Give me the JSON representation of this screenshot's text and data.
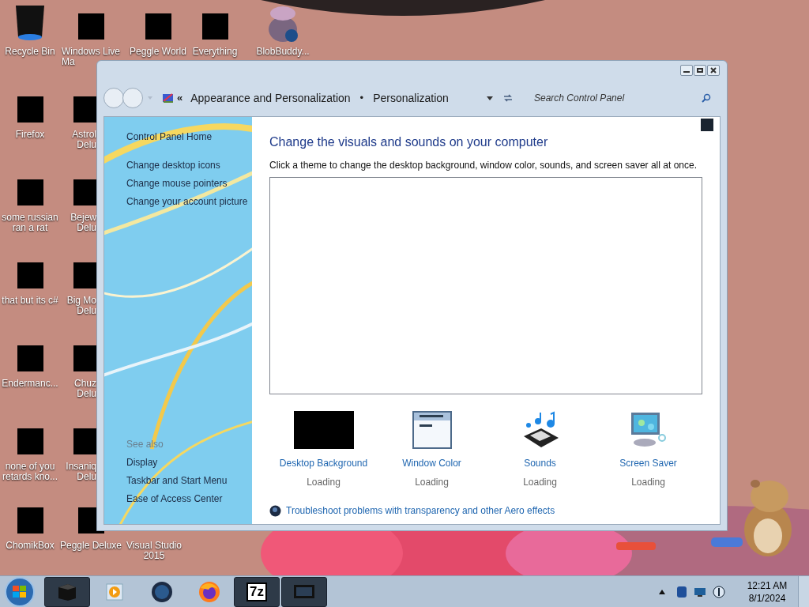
{
  "desktop_icons": [
    {
      "lines": [
        "Recycle Bin"
      ],
      "kind": "bin"
    },
    {
      "lines": [
        "Windows Live",
        "Ma"
      ],
      "kind": "redacted"
    },
    {
      "lines": [
        "Peggle World"
      ],
      "kind": "redacted"
    },
    {
      "lines": [
        "Everything"
      ],
      "kind": "redacted"
    },
    {
      "lines": [
        "BlobBuddy..."
      ],
      "kind": "blob"
    },
    {
      "lines": [
        "Firefox"
      ],
      "kind": "redacted"
    },
    {
      "lines": [
        "Astrol",
        "Delu"
      ],
      "kind": "redacted"
    },
    {
      "lines": [
        "some russian",
        "ran a rat"
      ],
      "kind": "redacted"
    },
    {
      "lines": [
        "Bejew",
        "Delu"
      ],
      "kind": "redacted"
    },
    {
      "lines": [
        "that but its c#"
      ],
      "kind": "redacted"
    },
    {
      "lines": [
        "Big Mo",
        "Delu"
      ],
      "kind": "redacted"
    },
    {
      "lines": [
        "Endermanc..."
      ],
      "kind": "redacted"
    },
    {
      "lines": [
        "Chuz",
        "Delu"
      ],
      "kind": "redacted"
    },
    {
      "lines": [
        "none of you",
        "retards kno..."
      ],
      "kind": "redacted"
    },
    {
      "lines": [
        "Insaniq",
        "Delu"
      ],
      "kind": "redacted"
    },
    {
      "lines": [
        "ChomikBox"
      ],
      "kind": "redacted"
    },
    {
      "lines": [
        "Peggle Deluxe"
      ],
      "kind": "redacted"
    },
    {
      "lines": [
        "Visual Studio",
        "2015"
      ],
      "kind": "blank"
    }
  ],
  "window": {
    "breadcrumb_chevron": "«",
    "breadcrumb": [
      "Appearance and Personalization",
      "Personalization"
    ],
    "breadcrumb_separator": "•",
    "search": {
      "placeholder": "Search Control Panel"
    },
    "sidebar": {
      "links": [
        "Control Panel Home",
        "Change desktop icons",
        "Change mouse pointers",
        "Change your account picture"
      ],
      "see_also_heading": "See also",
      "see_also": [
        "Display",
        "Taskbar and Start Menu",
        "Ease of Access Center"
      ]
    },
    "content": {
      "title": "Change the visuals and sounds on your computer",
      "subtitle": "Click a theme to change the desktop background, window color, sounds, and screen saver all at once.",
      "items": [
        {
          "label": "Desktop Background",
          "status": "Loading",
          "kind": "redacted"
        },
        {
          "label": "Window Color",
          "status": "Loading",
          "kind": "window"
        },
        {
          "label": "Sounds",
          "status": "Loading",
          "kind": "sounds"
        },
        {
          "label": "Screen Saver",
          "status": "Loading",
          "kind": "screensaver"
        }
      ],
      "troubleshoot": "Troubleshoot problems with transparency and other Aero effects"
    }
  },
  "taskbar": {
    "items": [
      {
        "kind": "computer",
        "running": true
      },
      {
        "kind": "media",
        "running": false
      },
      {
        "kind": "globe",
        "running": false
      },
      {
        "kind": "firefox",
        "running": false
      },
      {
        "kind": "text",
        "text": "7z",
        "running": true
      },
      {
        "kind": "monitor",
        "running": true
      }
    ],
    "time": "12:21 AM",
    "date": "8/1/2024"
  }
}
